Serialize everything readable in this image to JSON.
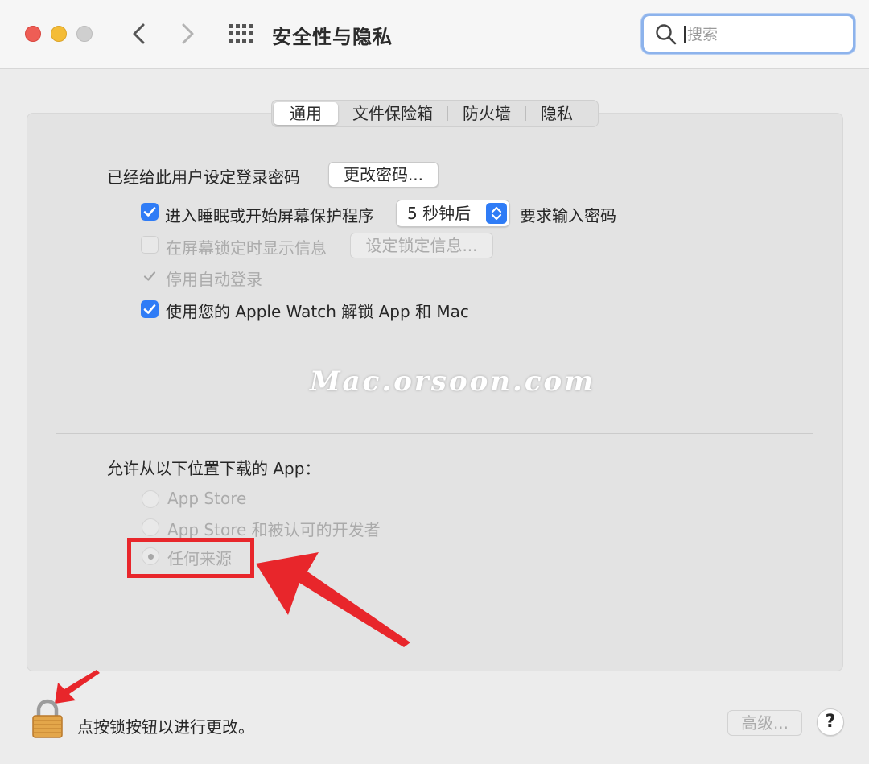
{
  "window": {
    "title": "安全性与隐私",
    "search_placeholder": "搜索"
  },
  "tabs": [
    {
      "label": "通用",
      "active": true
    },
    {
      "label": "文件保险箱",
      "active": false
    },
    {
      "label": "防火墙",
      "active": false
    },
    {
      "label": "隐私",
      "active": false
    }
  ],
  "general": {
    "password_set_label": "已经给此用户设定登录密码",
    "change_password_button": "更改密码...",
    "require_password": {
      "checked": true,
      "label": "进入睡眠或开始屏幕保护程序",
      "delay_value": "5 秒钟后",
      "suffix": "要求输入密码"
    },
    "show_message": {
      "checked": false,
      "enabled": false,
      "label": "在屏幕锁定时显示信息",
      "button": "设定锁定信息..."
    },
    "disable_auto_login": {
      "checked": true,
      "enabled": false,
      "label": "停用自动登录"
    },
    "apple_watch_unlock": {
      "checked": true,
      "label": "使用您的 Apple Watch 解锁 App 和 Mac"
    },
    "watermark": "Mac.orsoon.com",
    "allow_apps": {
      "heading": "允许从以下位置下载的 App：",
      "options": [
        {
          "label": "App Store",
          "selected": false
        },
        {
          "label": "App Store 和被认可的开发者",
          "selected": false
        },
        {
          "label": "任何来源",
          "selected": true
        }
      ]
    }
  },
  "footer": {
    "lock_text": "点按锁按钮以进行更改。",
    "advanced_button": "高级...",
    "help_button": "?"
  },
  "colors": {
    "accent": "#2f7cf6",
    "annotation_red": "#e8262b"
  }
}
